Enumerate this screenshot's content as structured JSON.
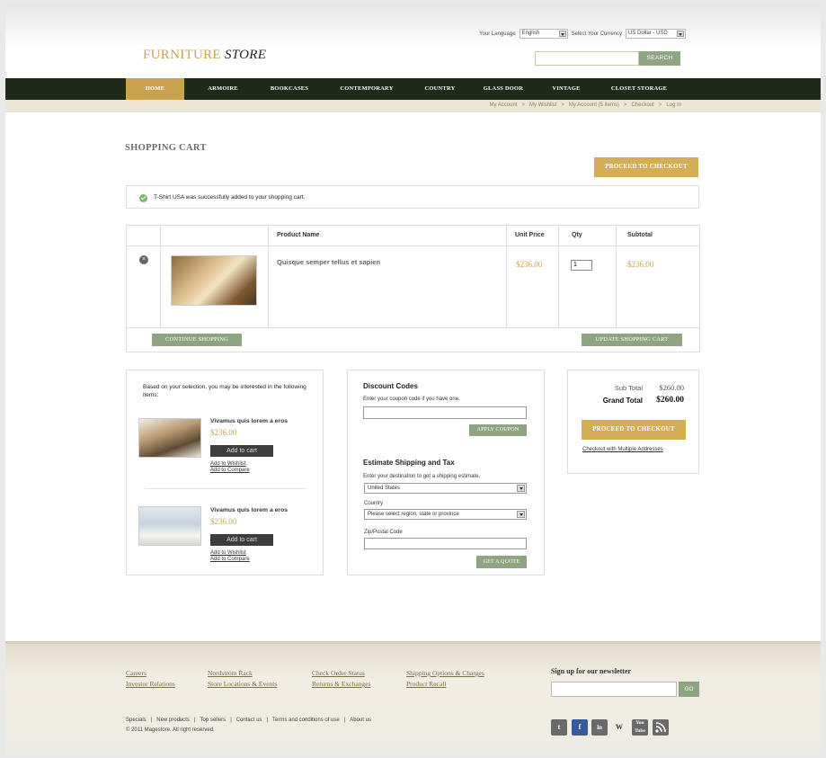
{
  "header": {
    "logo_part1": "FURNITURE",
    "logo_part2": "STORE",
    "language_label": "Your Language",
    "language_value": "English",
    "currency_label": "Select Your Currency",
    "currency_value": "US Dollar - USD",
    "search_button": "SEARCH"
  },
  "nav": {
    "items": [
      "HOME",
      "ARMOIRE",
      "BOOKCASES",
      "CONTEMPORARY",
      "COUNTRY",
      "GLASS DOOR",
      "VINTAGE",
      "CLOSET STORAGE"
    ]
  },
  "subnav": {
    "links": [
      "My Account",
      "My Wishlist",
      "My Account (5 items)",
      "Checkout",
      "Log In"
    ],
    "separator": ">"
  },
  "cart": {
    "title": "SHOPPING CART",
    "proceed_top": "PROCEED TO CHECKOUT",
    "notice": "T-Shirt USA was successfully added to your shopping cart.",
    "headers": {
      "product": "Product Name",
      "unit_price": "Unit Price",
      "qty": "Qty",
      "subtotal": "Subtotal"
    },
    "item": {
      "name": "Quisque semper tellus et sapien",
      "unit_price": "$236.00",
      "qty": "1",
      "subtotal": "$236.00"
    },
    "continue_button": "CONTINUE SHOPPING",
    "update_button": "UPDATE SHOPPING CART"
  },
  "recommend": {
    "intro": "Based on your selection, you may be interested in the following items:",
    "items": [
      {
        "name": "Vivamus quis lorem a eros",
        "price": "$236.00",
        "add": "Add to cart",
        "wishlist": "Add to Wishlist",
        "compare": "Add to Compare"
      },
      {
        "name": "Vivamus quis lorem a eros",
        "price": "$236.00",
        "add": "Add to cart",
        "wishlist": "Add to Wishlist",
        "compare": "Add to Compare"
      }
    ]
  },
  "discount": {
    "title": "Discount Codes",
    "prompt": "Enter your coupon code if you have one.",
    "apply": "APPLY COUPON",
    "shipping_title": "Estimate Shipping and Tax",
    "shipping_prompt": "Enter your destination to get a shipping estimate.",
    "country_value": "United States",
    "country_label": "Country",
    "region_value": "Please select region, state or province",
    "zip_label": "Zip/Postal Code",
    "quote": "GET A QUOTE"
  },
  "totals": {
    "sub_label": "Sub Total",
    "sub_value": "$260.00",
    "grand_label": "Grand Total",
    "grand_value": "$260.00",
    "proceed": "PROCEED TO CHECKOUT",
    "multiple": "Checkout with Multiple Addresses"
  },
  "footer": {
    "col1": [
      "Careers",
      "Investor Relations"
    ],
    "col2": [
      "Nordstrom Rack",
      "Store Locations & Events"
    ],
    "col3": [
      "Check Order Status",
      "Returns & Exchanges"
    ],
    "col4": [
      "Shipping Options & Charges",
      "Product Recall"
    ],
    "bottom_links": [
      "Specials",
      "New products",
      "Top sellers",
      "Contact us",
      "Terms and conditions of use",
      "About us"
    ],
    "separator": "|",
    "copyright": "© 2011 Magestore. All right reserved.",
    "newsletter_title": "Sign up for our newsletter",
    "newsletter_button": "GO",
    "social": [
      "twitter-icon",
      "facebook-icon",
      "linkedin-icon",
      "wikipedia-icon",
      "youtube-icon",
      "rss-icon"
    ]
  }
}
